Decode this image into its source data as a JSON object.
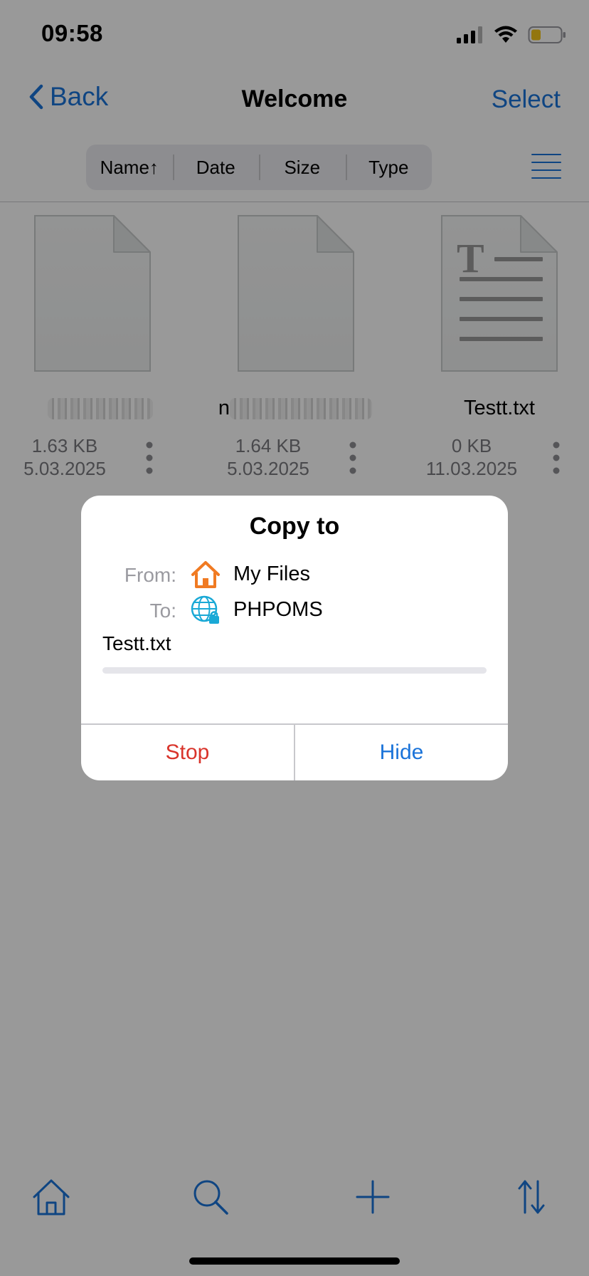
{
  "status_bar": {
    "time": "09:58"
  },
  "nav": {
    "back_label": "Back",
    "title": "Welcome",
    "select_label": "Select"
  },
  "sort": {
    "options": [
      "Name↑",
      "Date",
      "Size",
      "Type"
    ]
  },
  "files": [
    {
      "name": "",
      "size": "1.63 KB",
      "date": "5.03.2025",
      "kind": "document"
    },
    {
      "name": "n",
      "size": "1.64 KB",
      "date": "5.03.2025",
      "kind": "document"
    },
    {
      "name": "Testt.txt",
      "size": "0 KB",
      "date": "11.03.2025",
      "kind": "text"
    }
  ],
  "dialog": {
    "title": "Copy to",
    "from_label": "From:",
    "from_value": "My Files",
    "from_icon": "home-icon",
    "to_label": "To:",
    "to_value": "PHPOMS",
    "to_icon": "globe-lock-icon",
    "filename": "Testt.txt",
    "progress": 0,
    "stop_label": "Stop",
    "hide_label": "Hide"
  },
  "toolbar": {
    "icons": [
      "home-icon",
      "search-icon",
      "plus-icon",
      "sort-arrows-icon"
    ]
  },
  "colors": {
    "accent": "#1a73d9",
    "destructive": "#d9342b",
    "home_orange": "#f07a22",
    "globe_cyan": "#1aa9d6"
  }
}
